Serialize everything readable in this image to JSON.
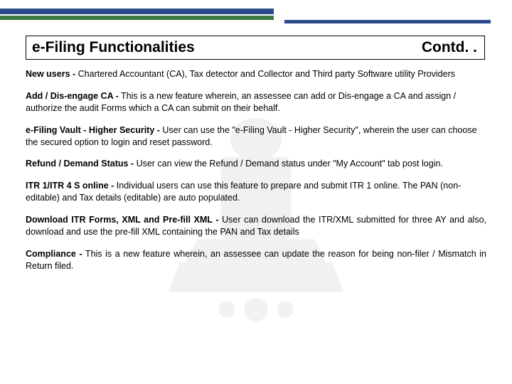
{
  "header": {
    "title": "e-Filing Functionalities",
    "contd": "Contd. ."
  },
  "items": [
    {
      "label": "New users -",
      "text": " Chartered Accountant (CA), Tax detector and Collector and Third party Software utility Providers",
      "justify": false
    },
    {
      "label": "Add / Dis-engage CA -",
      "text": " This is a new feature wherein, an assessee can add or Dis-engage a CA and assign / authorize the audit Forms which a CA can submit on their behalf.",
      "justify": false
    },
    {
      "label": "e-Filing Vault - Higher Security -",
      "text": " User can use the \"e-Filing Vault - Higher Security\", wherein the user can choose the secured option to login and reset password.",
      "justify": false
    },
    {
      "label": "Refund / Demand Status -",
      "text": " User can view the Refund / Demand status under \"My Account\" tab post login.",
      "justify": false
    },
    {
      "label": "ITR 1/ITR 4 S online -",
      "text": " Individual users can use this feature to prepare and submit ITR 1 online. The PAN (non-editable) and Tax details (editable) are auto populated.",
      "justify": false
    },
    {
      "label": "Download ITR Forms, XML and Pre-fill XML -",
      "text": " User can download the ITR/XML submitted for three AY and also, download and use the pre-fill XML containing the PAN and Tax details",
      "justify": true
    },
    {
      "label": "Compliance -",
      "text": " This is a new feature wherein, an assessee can update the reason for being non-filer / Mismatch in Return filed.",
      "justify": true
    }
  ]
}
